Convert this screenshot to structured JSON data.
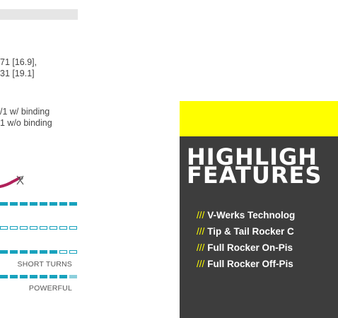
{
  "specs": {
    "line1": "71 [16.9],",
    "line2": "31 [19.1]",
    "line3": "/1 w/ binding",
    "line4": "1 w/o binding"
  },
  "bars": {
    "label_short_turns": "SHORT TURNS",
    "label_powerful": "POWERFUL"
  },
  "highlight": {
    "title_line1": "HIGHLIGH",
    "title_line2": "FEATURES",
    "prefix": "///",
    "features": [
      "V-Werks Technolog",
      "Tip & Tail Rocker C",
      "Full Rocker On-Pis",
      "Full Rocker Off-Pis"
    ]
  },
  "colors": {
    "accent": "#17a2bd",
    "highlight_yellow": "#ffff00",
    "panel_dark": "#3d3d3d",
    "squiggle": "#b0205a"
  }
}
